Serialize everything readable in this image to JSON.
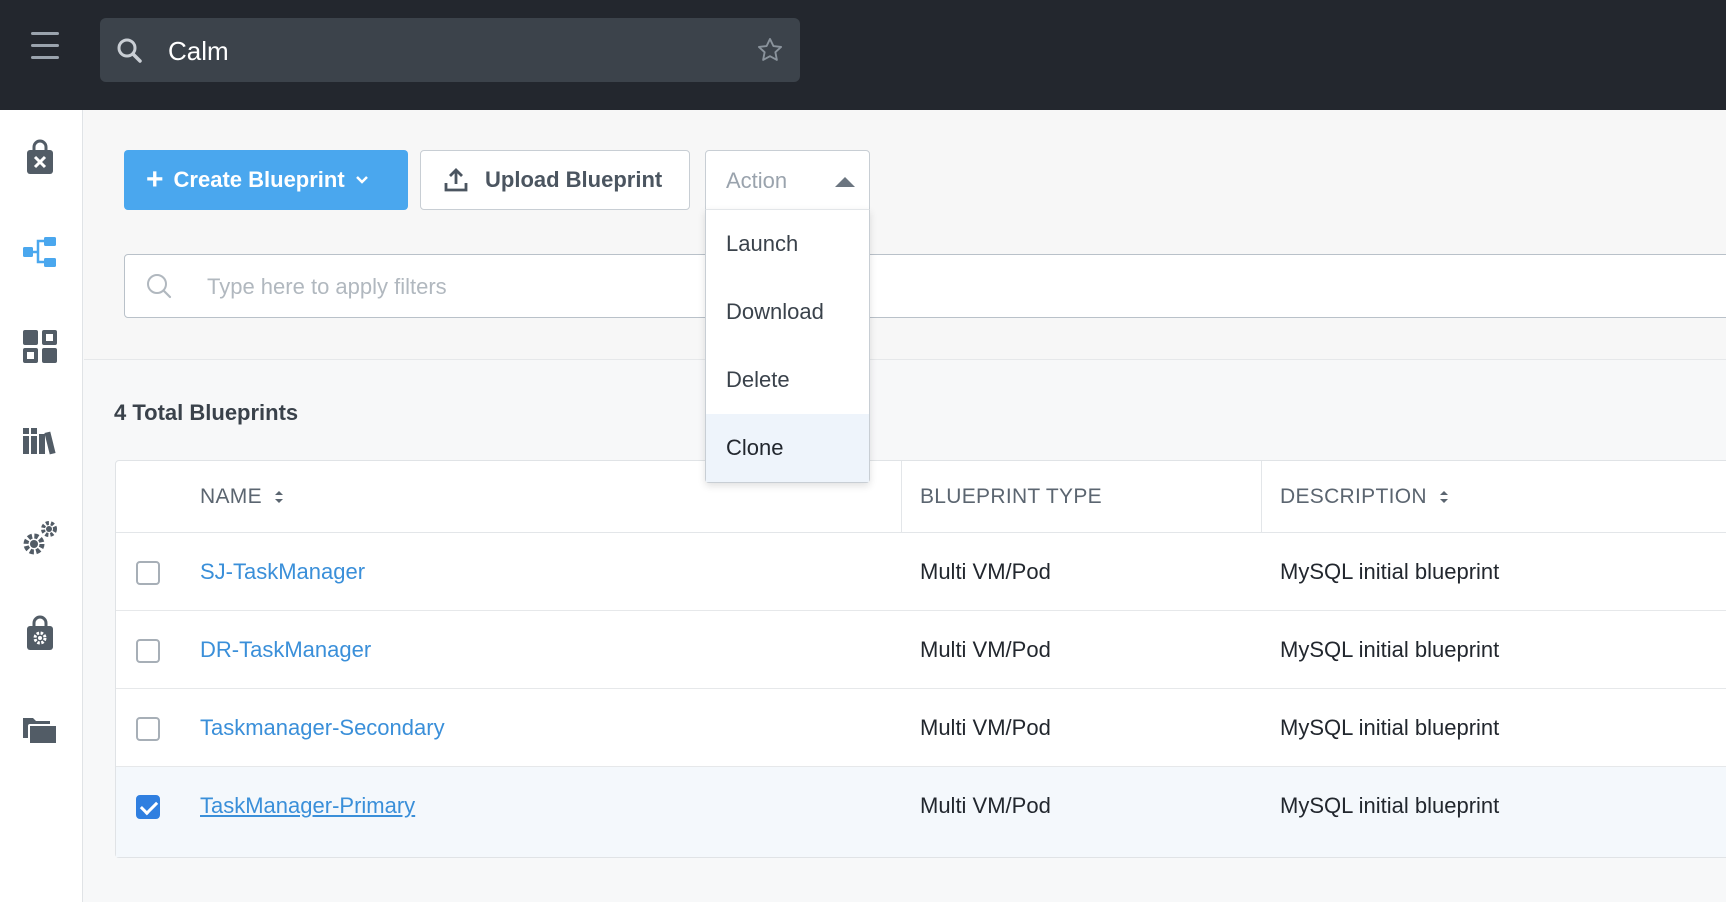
{
  "topbar": {
    "search_text": "Calm",
    "icons": [
      "hamburger-icon",
      "search-icon",
      "star-icon"
    ]
  },
  "sidebar": {
    "items": [
      {
        "name": "marketplace",
        "icon": "bag-x-icon"
      },
      {
        "name": "blueprints",
        "icon": "blueprint-tree-icon",
        "active": true
      },
      {
        "name": "applications",
        "icon": "grid-apps-icon"
      },
      {
        "name": "library",
        "icon": "books-icon"
      },
      {
        "name": "runbooks",
        "icon": "gears-icon"
      },
      {
        "name": "marketplace-manager",
        "icon": "bag-gear-icon"
      },
      {
        "name": "projects",
        "icon": "folders-icon"
      }
    ],
    "active_color": "#4aa7ee"
  },
  "toolbar": {
    "create_label": "Create Blueprint",
    "upload_label": "Upload Blueprint",
    "action_label": "Action",
    "action_menu": [
      "Launch",
      "Download",
      "Delete",
      "Clone"
    ],
    "action_highlighted": "Clone"
  },
  "filter": {
    "placeholder": "Type here to apply filters"
  },
  "summary": {
    "total_label": "4 Total Blueprints"
  },
  "table": {
    "columns": [
      "NAME",
      "BLUEPRINT TYPE",
      "DESCRIPTION"
    ],
    "rows": [
      {
        "name": "SJ-TaskManager",
        "type": "Multi VM/Pod",
        "description": "MySQL initial blueprint",
        "checked": false
      },
      {
        "name": "DR-TaskManager",
        "type": "Multi VM/Pod",
        "description": "MySQL initial blueprint",
        "checked": false
      },
      {
        "name": "Taskmanager-Secondary",
        "type": "Multi VM/Pod",
        "description": "MySQL initial blueprint",
        "checked": false
      },
      {
        "name": "TaskManager-Primary",
        "type": "Multi VM/Pod",
        "description": "MySQL initial blueprint",
        "checked": true
      }
    ]
  },
  "colors": {
    "topbar_bg": "#23272e",
    "primary_button": "#4aa7ee",
    "link": "#3a8fd9",
    "checkbox_checked": "#2f7fe0"
  }
}
